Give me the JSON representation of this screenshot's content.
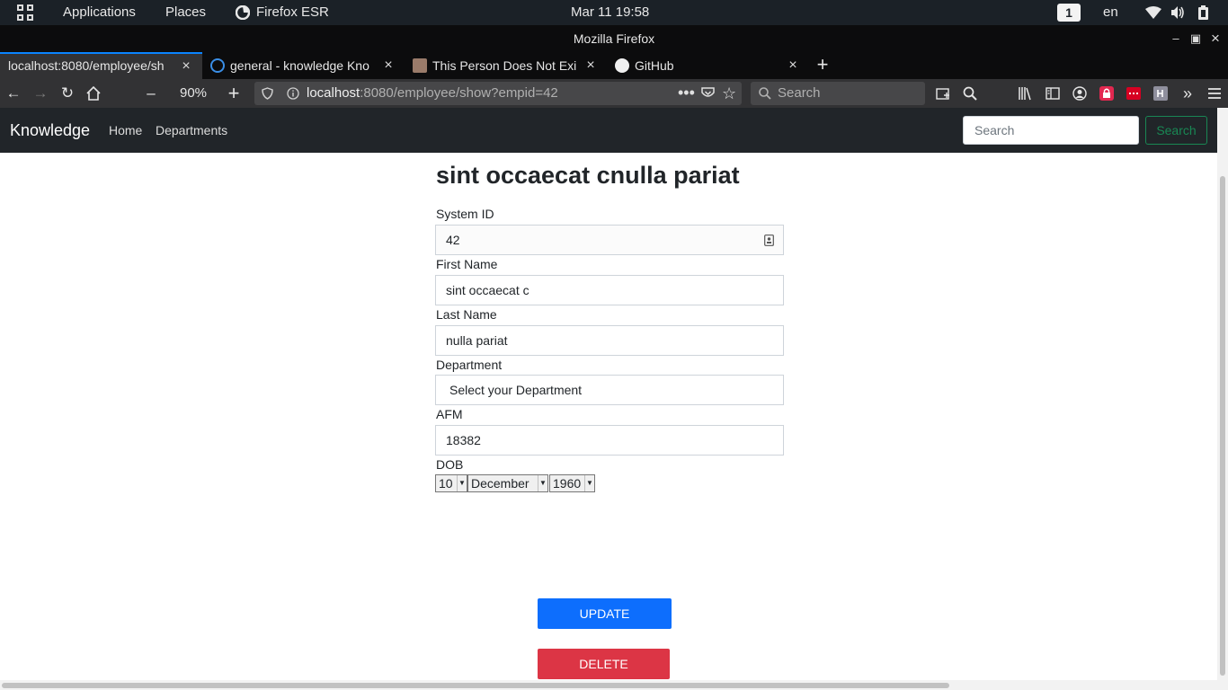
{
  "topbar": {
    "applications_label": "Applications",
    "places_label": "Places",
    "active_app_label": "Firefox ESR",
    "clock": "Mar 11  19:58",
    "workspace_number": "1",
    "language": "en"
  },
  "window": {
    "title": "Mozilla Firefox"
  },
  "tabs": [
    {
      "label": "localhost:8080/employee/sh",
      "active": true
    },
    {
      "label": "general - knowledge Kno",
      "active": false
    },
    {
      "label": "This Person Does Not Exi",
      "active": false
    },
    {
      "label": "GitHub",
      "active": false
    }
  ],
  "navbar": {
    "zoom_level": "90%",
    "url_host": "localhost",
    "url_rest": ":8080/employee/show?empid=42",
    "search_placeholder": "Search"
  },
  "app": {
    "brand": "Knowledge",
    "nav_links": [
      "Home",
      "Departments"
    ],
    "search_placeholder": "Search",
    "search_button_label": "Search",
    "accent_color": "#198754"
  },
  "employee": {
    "heading": "sint occaecat cnulla pariat",
    "fields": {
      "system_id": {
        "label": "System ID",
        "value": "42"
      },
      "first_name": {
        "label": "First Name",
        "value": "sint occaecat c"
      },
      "last_name": {
        "label": "Last Name",
        "value": "nulla pariat"
      },
      "department": {
        "label": "Department",
        "value": "Select your Department"
      },
      "afm": {
        "label": "AFM",
        "value": "18382"
      }
    },
    "dob": {
      "label": "DOB",
      "day": "10",
      "month": "December",
      "year": "1960"
    },
    "update_label": "UPDATE",
    "delete_label": "DELETE",
    "update_color": "#0d6efd",
    "delete_color": "#dc3545"
  }
}
